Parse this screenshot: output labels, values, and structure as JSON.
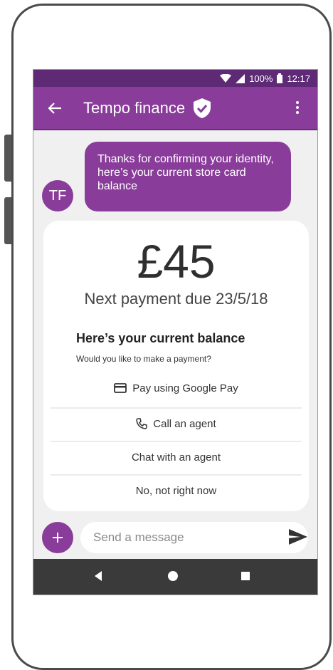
{
  "status_bar": {
    "battery": "100%",
    "time": "12:17"
  },
  "app_bar": {
    "title": "Tempo finance"
  },
  "chat": {
    "avatar_initials": "TF",
    "bubble_text": "Thanks for confirming your identity, here’s your current store card balance"
  },
  "card": {
    "amount": "£45",
    "due_text": "Next payment due 23/5/18",
    "heading": "Here’s your current balance",
    "subtext": "Would you like to make a payment?",
    "options": [
      {
        "label": "Pay using Google Pay",
        "icon": "credit-card-icon"
      },
      {
        "label": "Call an agent",
        "icon": "phone-icon"
      },
      {
        "label": "Chat with an agent"
      },
      {
        "label": "No, not right now"
      }
    ]
  },
  "composer": {
    "placeholder": "Send a message"
  },
  "colors": {
    "status_bar": "#5e2a75",
    "app_bar": "#8a3c9b",
    "accent": "#8a3c9b",
    "nav_bar": "#3a3a3a"
  }
}
